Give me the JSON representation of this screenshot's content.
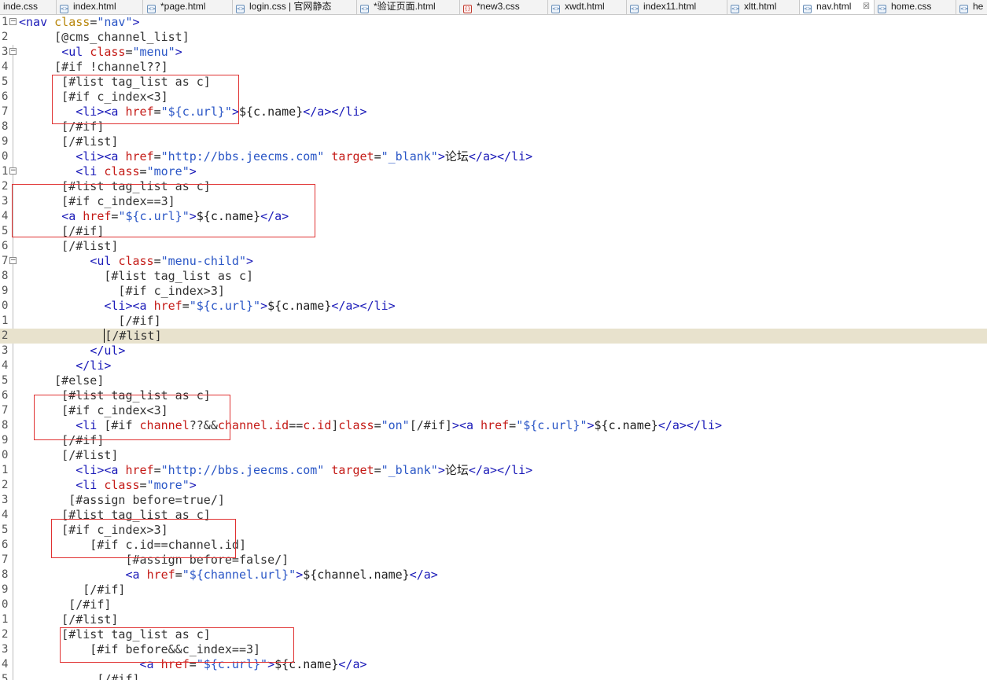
{
  "tabs": [
    {
      "label": "inde.css",
      "icon": "file-icon",
      "kind": "plain"
    },
    {
      "label": "index.html",
      "icon": "html-file-icon",
      "kind": "html"
    },
    {
      "label": "*page.html",
      "icon": "html-file-icon",
      "kind": "html"
    },
    {
      "label": "login.css | 官网静态",
      "icon": "html-file-icon",
      "kind": "html"
    },
    {
      "label": "*验证页面.html",
      "icon": "html-file-icon",
      "kind": "html"
    },
    {
      "label": "*new3.css",
      "icon": "css-file-icon",
      "kind": "css"
    },
    {
      "label": "xwdt.html",
      "icon": "html-file-icon",
      "kind": "html"
    },
    {
      "label": "index11.html",
      "icon": "html-file-icon",
      "kind": "html"
    },
    {
      "label": "xltt.html",
      "icon": "html-file-icon",
      "kind": "html"
    },
    {
      "label": "nav.html",
      "icon": "html-file-icon",
      "kind": "html",
      "active": true,
      "close": "☒"
    },
    {
      "label": "home.css",
      "icon": "html-file-icon",
      "kind": "html"
    },
    {
      "label": "he",
      "icon": "html-file-icon",
      "kind": "html"
    }
  ],
  "editor": {
    "current_line": 22,
    "lines": [
      {
        "num": "1",
        "fold": "−",
        "tokens": [
          [
            "tag",
            "<nav "
          ],
          [
            "attr",
            "class"
          ],
          [
            "text",
            "="
          ],
          [
            "val",
            "\"nav\""
          ],
          [
            "tag",
            ">"
          ]
        ]
      },
      {
        "num": "2",
        "tokens": [
          [
            "ftl",
            "     [@cms_channel_list]"
          ]
        ]
      },
      {
        "num": "3",
        "fold": "−",
        "tokens": [
          [
            "text",
            "      "
          ],
          [
            "tag",
            "<ul "
          ],
          [
            "attrred",
            "class"
          ],
          [
            "text",
            "="
          ],
          [
            "val",
            "\"menu\""
          ],
          [
            "tag",
            ">"
          ]
        ]
      },
      {
        "num": "4",
        "tokens": [
          [
            "ftl",
            "     [#if !channel??]"
          ]
        ]
      },
      {
        "num": "5",
        "tokens": [
          [
            "ftl",
            "      [#list tag_list as c]"
          ]
        ]
      },
      {
        "num": "6",
        "tokens": [
          [
            "ftl",
            "      [#if c_index<3]"
          ]
        ]
      },
      {
        "num": "7",
        "tokens": [
          [
            "text",
            "        "
          ],
          [
            "tag",
            "<li><a "
          ],
          [
            "attrred",
            "href"
          ],
          [
            "text",
            "="
          ],
          [
            "val",
            "\"${c.url}\""
          ],
          [
            "tag",
            ">"
          ],
          [
            "text",
            "${c.name}"
          ],
          [
            "tag",
            "</a></li>"
          ]
        ]
      },
      {
        "num": "8",
        "tokens": [
          [
            "ftl",
            "      [/#if]"
          ]
        ]
      },
      {
        "num": "9",
        "tokens": [
          [
            "ftl",
            "      [/#list]"
          ]
        ]
      },
      {
        "num": "0",
        "tokens": [
          [
            "text",
            "        "
          ],
          [
            "tag",
            "<li><a "
          ],
          [
            "attrred",
            "href"
          ],
          [
            "text",
            "="
          ],
          [
            "val",
            "\"http://bbs.jeecms.com\""
          ],
          [
            "text",
            " "
          ],
          [
            "attrred",
            "target"
          ],
          [
            "text",
            "="
          ],
          [
            "val",
            "\"_blank\""
          ],
          [
            "tag",
            ">"
          ],
          [
            "text",
            "论坛"
          ],
          [
            "tag",
            "</a></li>"
          ]
        ]
      },
      {
        "num": "1",
        "fold": "−",
        "tokens": [
          [
            "text",
            "        "
          ],
          [
            "tag",
            "<li "
          ],
          [
            "attrred",
            "class"
          ],
          [
            "text",
            "="
          ],
          [
            "val",
            "\"more\""
          ],
          [
            "tag",
            ">"
          ]
        ]
      },
      {
        "num": "2",
        "tokens": [
          [
            "ftl",
            "      [#list tag_list as c]"
          ]
        ]
      },
      {
        "num": "3",
        "tokens": [
          [
            "ftl",
            "      [#if c_index==3]"
          ]
        ]
      },
      {
        "num": "4",
        "tokens": [
          [
            "text",
            "      "
          ],
          [
            "tag",
            "<a "
          ],
          [
            "attrred",
            "href"
          ],
          [
            "text",
            "="
          ],
          [
            "val",
            "\"${c.url}\""
          ],
          [
            "tag",
            ">"
          ],
          [
            "text",
            "${c.name}"
          ],
          [
            "tag",
            "</a>"
          ]
        ]
      },
      {
        "num": "5",
        "tokens": [
          [
            "ftl",
            "      [/#if]"
          ]
        ]
      },
      {
        "num": "6",
        "tokens": [
          [
            "ftl",
            "      [/#list]"
          ]
        ]
      },
      {
        "num": "7",
        "fold": "−",
        "tokens": [
          [
            "text",
            "          "
          ],
          [
            "tag",
            "<ul "
          ],
          [
            "attrred",
            "class"
          ],
          [
            "text",
            "="
          ],
          [
            "val",
            "\"menu-child\""
          ],
          [
            "tag",
            ">"
          ]
        ]
      },
      {
        "num": "8",
        "tokens": [
          [
            "ftl",
            "            [#list tag_list as c]"
          ]
        ]
      },
      {
        "num": "9",
        "tokens": [
          [
            "ftl",
            "              [#if c_index>3]"
          ]
        ]
      },
      {
        "num": "0",
        "tokens": [
          [
            "text",
            "            "
          ],
          [
            "tag",
            "<li><a "
          ],
          [
            "attrred",
            "href"
          ],
          [
            "text",
            "="
          ],
          [
            "val",
            "\"${c.url}\""
          ],
          [
            "tag",
            ">"
          ],
          [
            "text",
            "${c.name}"
          ],
          [
            "tag",
            "</a></li>"
          ]
        ]
      },
      {
        "num": "1",
        "tokens": [
          [
            "ftl",
            "              [/#if]"
          ]
        ]
      },
      {
        "num": "2",
        "tokens": [
          [
            "ftl",
            "            "
          ],
          [
            "caret",
            "["
          ],
          [
            "ftl",
            "/#list]"
          ]
        ]
      },
      {
        "num": "3",
        "tokens": [
          [
            "text",
            "          "
          ],
          [
            "tag",
            "</ul>"
          ]
        ]
      },
      {
        "num": "4",
        "tokens": [
          [
            "text",
            "        "
          ],
          [
            "tag",
            "</li>"
          ]
        ]
      },
      {
        "num": "5",
        "tokens": [
          [
            "ftl",
            "     [#else]"
          ]
        ]
      },
      {
        "num": "6",
        "tokens": [
          [
            "ftl",
            "      [#list tag_list as c]"
          ]
        ]
      },
      {
        "num": "7",
        "tokens": [
          [
            "ftl",
            "      [#if c_index<3]"
          ]
        ]
      },
      {
        "num": "8",
        "tokens": [
          [
            "text",
            "        "
          ],
          [
            "tag",
            "<li "
          ],
          [
            "ftl",
            "[#if "
          ],
          [
            "attrred",
            "channel"
          ],
          [
            "ftl",
            "??&&"
          ],
          [
            "attrred",
            "channel.id"
          ],
          [
            "text",
            "=="
          ],
          [
            "attrred",
            "c.id"
          ],
          [
            "ftl",
            "]"
          ],
          [
            "attrred",
            "class"
          ],
          [
            "text",
            "="
          ],
          [
            "val",
            "\"on\""
          ],
          [
            "ftl",
            "[/#if]"
          ],
          [
            "tag",
            ">"
          ],
          [
            "tag",
            "<a "
          ],
          [
            "attrred",
            "href"
          ],
          [
            "text",
            "="
          ],
          [
            "val",
            "\"${c.url}\""
          ],
          [
            "tag",
            ">"
          ],
          [
            "text",
            "${c.name}"
          ],
          [
            "tag",
            "</a></li>"
          ]
        ]
      },
      {
        "num": "9",
        "tokens": [
          [
            "ftl",
            "      [/#if]"
          ]
        ]
      },
      {
        "num": "0",
        "tokens": [
          [
            "ftl",
            "      [/#list]"
          ]
        ]
      },
      {
        "num": "1",
        "tokens": [
          [
            "text",
            "        "
          ],
          [
            "tag",
            "<li><a "
          ],
          [
            "attrred",
            "href"
          ],
          [
            "text",
            "="
          ],
          [
            "val",
            "\"http://bbs.jeecms.com\""
          ],
          [
            "text",
            " "
          ],
          [
            "attrred",
            "target"
          ],
          [
            "text",
            "="
          ],
          [
            "val",
            "\"_blank\""
          ],
          [
            "tag",
            ">"
          ],
          [
            "text",
            "论坛"
          ],
          [
            "tag",
            "</a></li>"
          ]
        ]
      },
      {
        "num": "2",
        "tokens": [
          [
            "text",
            "        "
          ],
          [
            "tag",
            "<li "
          ],
          [
            "attrred",
            "class"
          ],
          [
            "text",
            "="
          ],
          [
            "val",
            "\"more\""
          ],
          [
            "tag",
            ">"
          ]
        ]
      },
      {
        "num": "3",
        "tokens": [
          [
            "ftl",
            "       [#assign before=true/]"
          ]
        ]
      },
      {
        "num": "4",
        "tokens": [
          [
            "ftl",
            "      [#list tag_list as c]"
          ]
        ]
      },
      {
        "num": "5",
        "tokens": [
          [
            "ftl",
            "      [#if c_index>3]"
          ]
        ]
      },
      {
        "num": "6",
        "tokens": [
          [
            "ftl",
            "          [#if c.id==channel.id]"
          ]
        ]
      },
      {
        "num": "7",
        "tokens": [
          [
            "ftl",
            "               [#assign before=false/]"
          ]
        ]
      },
      {
        "num": "8",
        "tokens": [
          [
            "text",
            "               "
          ],
          [
            "tag",
            "<a "
          ],
          [
            "attrred",
            "href"
          ],
          [
            "text",
            "="
          ],
          [
            "val",
            "\"${channel.url}\""
          ],
          [
            "tag",
            ">"
          ],
          [
            "text",
            "${channel.name}"
          ],
          [
            "tag",
            "</a>"
          ]
        ]
      },
      {
        "num": "9",
        "tokens": [
          [
            "ftl",
            "         [/#if]"
          ]
        ]
      },
      {
        "num": "0",
        "tokens": [
          [
            "ftl",
            "       [/#if]"
          ]
        ]
      },
      {
        "num": "1",
        "tokens": [
          [
            "ftl",
            "      [/#list]"
          ]
        ]
      },
      {
        "num": "2",
        "tokens": [
          [
            "ftl",
            "      [#list tag_list as c]"
          ]
        ]
      },
      {
        "num": "3",
        "tokens": [
          [
            "ftl",
            "          [#if before&&c_index==3]"
          ]
        ]
      },
      {
        "num": "4",
        "tokens": [
          [
            "text",
            "                 "
          ],
          [
            "tag",
            "<a "
          ],
          [
            "attrred",
            "href"
          ],
          [
            "text",
            "="
          ],
          [
            "val",
            "\"${c.url}\""
          ],
          [
            "tag",
            ">"
          ],
          [
            "text",
            "${c.name}"
          ],
          [
            "tag",
            "</a>"
          ]
        ]
      },
      {
        "num": "5",
        "tokens": [
          [
            "ftl",
            "           [/#if]"
          ]
        ]
      }
    ]
  },
  "colors": {
    "tag": "#1a1ab8",
    "attribute": "#c41a16",
    "value": "#2a56c6",
    "current_line": "#e8e2cd",
    "annotation_box": "#e03232"
  }
}
